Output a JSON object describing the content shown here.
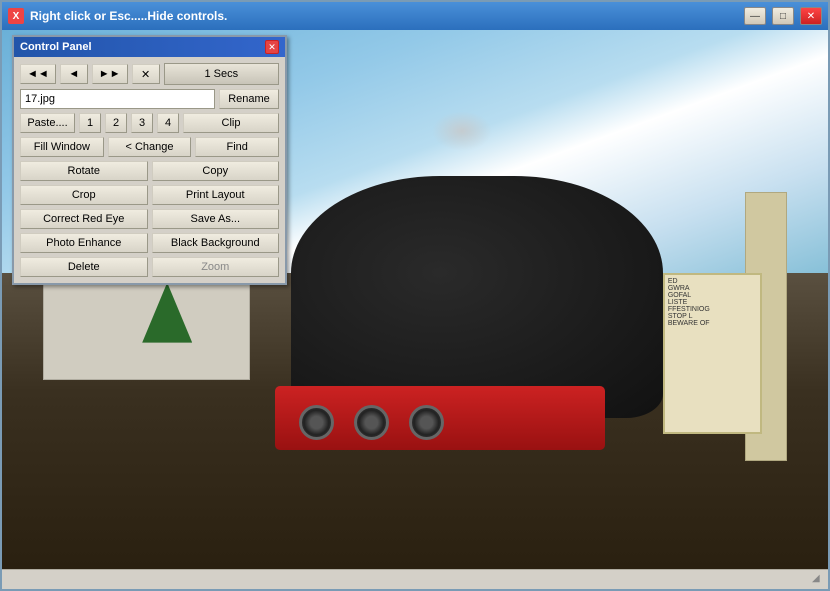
{
  "window": {
    "title": "Right click or Esc.....Hide controls.",
    "icon": "X",
    "min_label": "—",
    "max_label": "□",
    "close_label": "✕"
  },
  "panel": {
    "title": "Control Panel",
    "close_label": "✕",
    "nav": {
      "prev_prev": "◄◄",
      "prev": "◄",
      "next": "►►",
      "close": "✕",
      "secs": "1 Secs"
    },
    "filename": "17.jpg",
    "rename_label": "Rename",
    "paste_label": "Paste....",
    "num1": "1",
    "num2": "2",
    "num3": "3",
    "num4": "4",
    "clip_label": "Clip",
    "fill_window_label": "Fill Window",
    "change_label": "< Change",
    "find_label": "Find",
    "buttons": {
      "rotate": "Rotate",
      "copy": "Copy",
      "crop": "Crop",
      "print_layout": "Print Layout",
      "correct_red_eye": "Correct Red Eye",
      "save_as": "Save As...",
      "photo_enhance": "Photo Enhance",
      "black_background": "Black Background",
      "delete": "Delete",
      "zoom": "Zoom"
    }
  },
  "sign": {
    "lines": [
      "ED",
      "GWRA",
      "GOFAL",
      "LISTE",
      "FFESTINIOG",
      "STOP L",
      "BEWARE OF"
    ]
  },
  "colors": {
    "panel_title_bg": "#2255aa",
    "window_title_bg": "#2b6fbd",
    "button_bg": "#d8d4c8",
    "input_bg": "#ffffff"
  }
}
